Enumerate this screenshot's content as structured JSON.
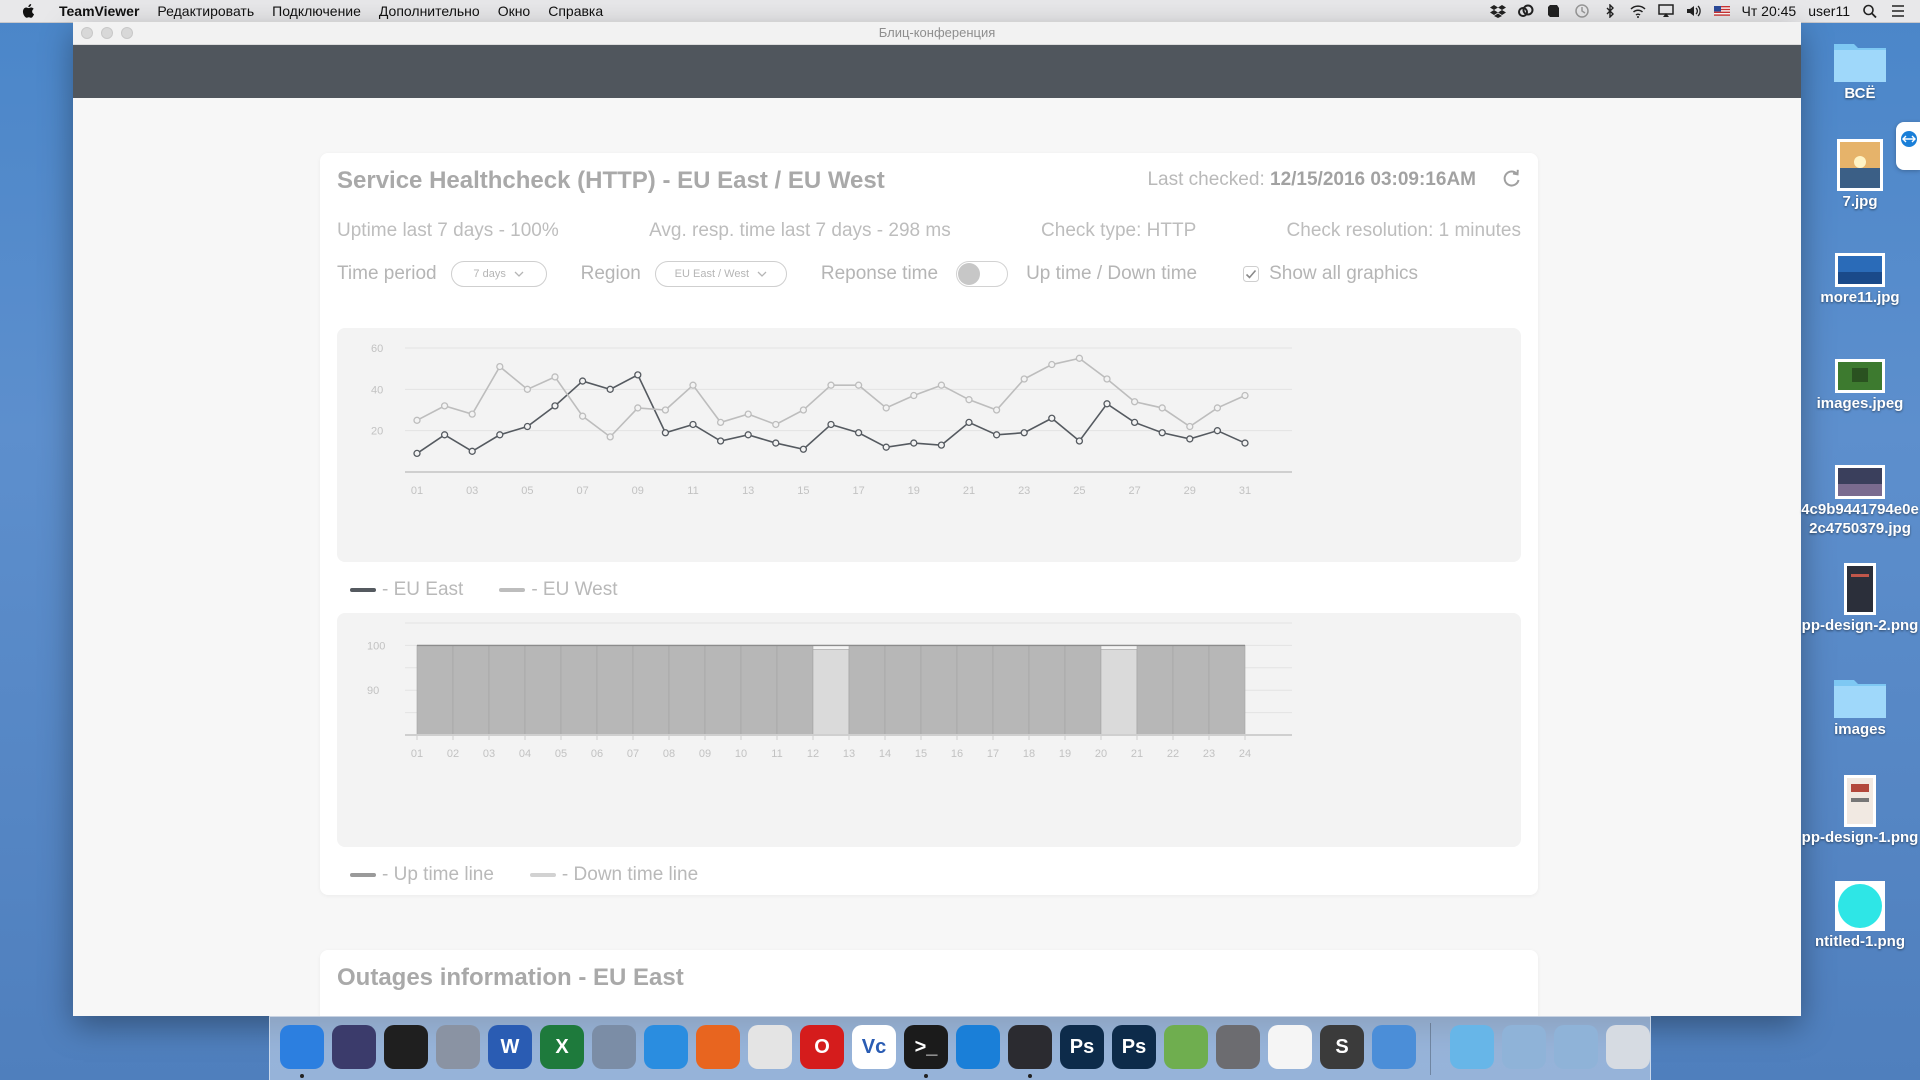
{
  "menubar": {
    "app_name": "TeamViewer",
    "items": [
      "Редактировать",
      "Подключение",
      "Дополнительно",
      "Окно",
      "Справка"
    ],
    "clock": "Чт 20:45",
    "user": "user11"
  },
  "window": {
    "title": "Блиц-конференция"
  },
  "card": {
    "title": "Service Healthcheck (HTTP) - EU East / EU West",
    "last_checked_label": "Last checked:",
    "last_checked_value": "12/15/2016 03:09:16AM",
    "stats": {
      "uptime": "Uptime last 7 days - 100%",
      "avg_resp": "Avg. resp. time last 7 days - 298 ms",
      "check_type": "Check type: HTTP",
      "check_resolution": "Check resolution: 1 minutes"
    },
    "controls": {
      "time_period_label": "Time period",
      "time_period_value": "7 days",
      "region_label": "Region",
      "region_value": "EU East / West",
      "response_time_label": "Reponse time",
      "uptime_label": "Up time / Down time",
      "show_all_label": "Show all graphics",
      "response_toggle_on": false,
      "show_all_checked": true
    },
    "legend1": {
      "east": "- EU East",
      "west": "- EU West"
    },
    "legend2": {
      "up": "- Up time line",
      "down": "- Down time line"
    }
  },
  "card2": {
    "title": "Outages information - EU East"
  },
  "colors": {
    "east": "#555a60",
    "west": "#bdbdbd",
    "up_bar": "#b7b7b7",
    "down_bar": "#dadada"
  },
  "chart_data": [
    {
      "type": "line",
      "x": [
        "01",
        "02",
        "03",
        "04",
        "05",
        "06",
        "07",
        "08",
        "09",
        "10",
        "11",
        "12",
        "13",
        "14",
        "15",
        "16",
        "17",
        "18",
        "19",
        "20",
        "21",
        "22",
        "23",
        "24",
        "25",
        "26",
        "27",
        "28",
        "29",
        "30",
        "31"
      ],
      "xticks": [
        "01",
        "03",
        "05",
        "07",
        "09",
        "11",
        "13",
        "15",
        "17",
        "19",
        "21",
        "23",
        "25",
        "27",
        "29",
        "31"
      ],
      "yticks": [
        "20",
        "40",
        "60"
      ],
      "ylim": [
        0,
        60
      ],
      "series": [
        {
          "name": "EU East",
          "values": [
            9,
            18,
            10,
            18,
            22,
            32,
            44,
            40,
            47,
            19,
            23,
            15,
            18,
            14,
            11,
            23,
            19,
            12,
            14,
            13,
            24,
            18,
            19,
            26,
            15,
            33,
            24,
            19,
            16,
            20,
            14
          ]
        },
        {
          "name": "EU West",
          "values": [
            25,
            32,
            28,
            51,
            40,
            46,
            27,
            17,
            31,
            30,
            42,
            24,
            28,
            23,
            30,
            42,
            42,
            31,
            37,
            42,
            35,
            30,
            45,
            52,
            55,
            45,
            34,
            31,
            22,
            31,
            37
          ]
        }
      ]
    },
    {
      "type": "bar",
      "categories": [
        "01",
        "02",
        "03",
        "04",
        "05",
        "06",
        "07",
        "08",
        "09",
        "10",
        "11",
        "12",
        "13",
        "14",
        "15",
        "16",
        "17",
        "18",
        "19",
        "20",
        "21",
        "22",
        "23",
        "24"
      ],
      "yticks": [
        "90",
        "100"
      ],
      "ylim": [
        80,
        105
      ],
      "series": [
        {
          "name": "Up time line",
          "values": [
            100,
            100,
            100,
            100,
            100,
            100,
            100,
            100,
            100,
            100,
            100,
            99,
            100,
            100,
            100,
            100,
            100,
            100,
            100,
            99,
            100,
            100,
            100,
            100
          ]
        }
      ],
      "down_categories": [
        "12",
        "20"
      ]
    }
  ],
  "desktop": {
    "icons": [
      {
        "label": "ВСЁ",
        "kind": "folder"
      },
      {
        "label": "7.jpg",
        "kind": "photo-sunset"
      },
      {
        "label": "more11.jpg",
        "kind": "photo-sea"
      },
      {
        "label": "images.jpeg",
        "kind": "photo-green"
      },
      {
        "label": "4c9b9441794e0e",
        "label2": "2c4750379.jpg",
        "kind": "photo-dark"
      },
      {
        "label": "pp-design-2.png",
        "kind": "phone"
      },
      {
        "label": "images",
        "kind": "folder"
      },
      {
        "label": "pp-design-1.png",
        "kind": "doc"
      },
      {
        "label": "ntitled-1.png",
        "kind": "cyan-circle"
      }
    ]
  },
  "dock": {
    "apps": [
      "Finder",
      "Siri",
      "Activity",
      "Launchpad",
      "Word",
      "Excel",
      "Preview",
      "Safari",
      "Firefox",
      "Chrome",
      "Opera",
      "VNC",
      "Terminal",
      "TeamViewer",
      "Steam",
      "Photoshop",
      "Photoshop CC",
      "Keyboard",
      "System Preferences",
      "Photos",
      "Sublime Text",
      "Xcode",
      "Downloads",
      "Folder",
      "Folder",
      "Trash"
    ]
  }
}
